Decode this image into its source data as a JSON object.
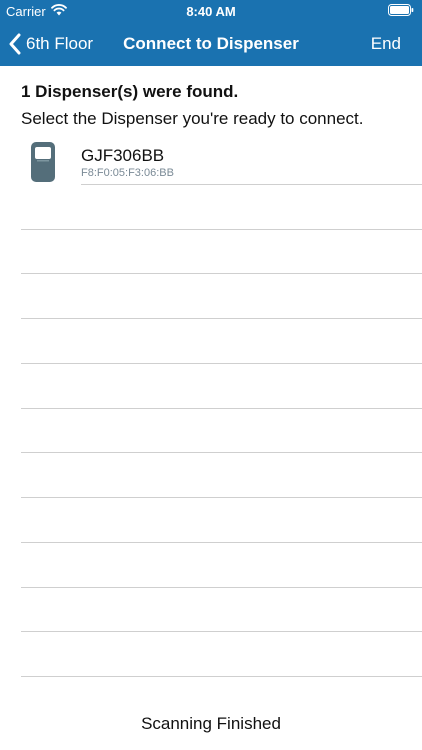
{
  "status_bar": {
    "carrier": "Carrier",
    "time": "8:40 AM",
    "wifi_icon": "wifi-icon",
    "battery_icon": "battery-icon"
  },
  "nav": {
    "back_label": "6th Floor",
    "title": "Connect to Dispenser",
    "end_label": "End",
    "back_icon": "chevron-left-icon"
  },
  "content": {
    "found_title": "1 Dispenser(s) were found.",
    "instructions": "Select the Dispenser you're ready to connect."
  },
  "dispensers": [
    {
      "name": "GJF306BB",
      "mac": "F8:F0:05:F3:06:BB",
      "icon": "dispenser-icon"
    }
  ],
  "footer": {
    "status": "Scanning Finished"
  },
  "colors": {
    "header_bg": "#1a72b0",
    "header_text": "#ffffff",
    "divider": "#cfcfcf",
    "mac_text": "#7a8a96",
    "dispenser_icon": "#546e7a"
  }
}
